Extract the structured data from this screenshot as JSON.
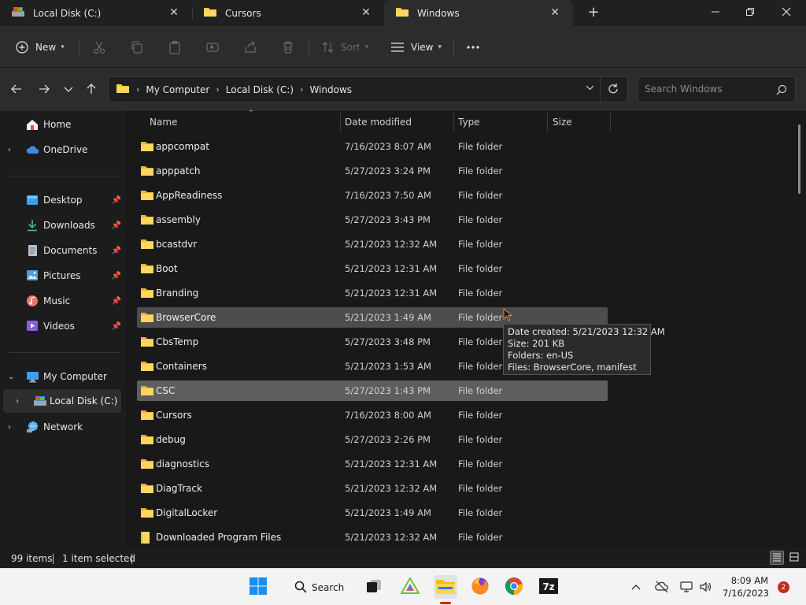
{
  "tabs": [
    {
      "label": "Local Disk (C:)",
      "icon": "drive-icon",
      "active": false
    },
    {
      "label": "Cursors",
      "icon": "folder-icon",
      "active": false
    },
    {
      "label": "Windows",
      "icon": "folder-icon",
      "active": true
    }
  ],
  "toolbar": {
    "new_label": "New",
    "sort_label": "Sort",
    "view_label": "View",
    "more_label": "···"
  },
  "address": {
    "crumbs": [
      "My Computer",
      "Local Disk (C:)",
      "Windows"
    ]
  },
  "search": {
    "placeholder": "Search Windows"
  },
  "nav": {
    "home": "Home",
    "onedrive": "OneDrive",
    "desktop": "Desktop",
    "downloads": "Downloads",
    "documents": "Documents",
    "pictures": "Pictures",
    "music": "Music",
    "videos": "Videos",
    "mycomputer": "My Computer",
    "localdisk": "Local Disk (C:)",
    "network": "Network"
  },
  "columns": {
    "name": "Name",
    "date": "Date modified",
    "type": "Type",
    "size": "Size"
  },
  "files": [
    {
      "name": "appcompat",
      "date": "7/16/2023 8:07 AM",
      "type": "File folder"
    },
    {
      "name": "apppatch",
      "date": "5/27/2023 3:24 PM",
      "type": "File folder"
    },
    {
      "name": "AppReadiness",
      "date": "7/16/2023 7:50 AM",
      "type": "File folder"
    },
    {
      "name": "assembly",
      "date": "5/27/2023 3:43 PM",
      "type": "File folder"
    },
    {
      "name": "bcastdvr",
      "date": "5/21/2023 12:32 AM",
      "type": "File folder"
    },
    {
      "name": "Boot",
      "date": "5/21/2023 12:31 AM",
      "type": "File folder"
    },
    {
      "name": "Branding",
      "date": "5/21/2023 12:31 AM",
      "type": "File folder"
    },
    {
      "name": "BrowserCore",
      "date": "5/21/2023 1:49 AM",
      "type": "File folder"
    },
    {
      "name": "CbsTemp",
      "date": "5/27/2023 3:48 PM",
      "type": "File folder"
    },
    {
      "name": "Containers",
      "date": "5/21/2023 1:53 AM",
      "type": "File folder"
    },
    {
      "name": "CSC",
      "date": "5/27/2023 1:43 PM",
      "type": "File folder"
    },
    {
      "name": "Cursors",
      "date": "7/16/2023 8:00 AM",
      "type": "File folder"
    },
    {
      "name": "debug",
      "date": "5/27/2023 2:26 PM",
      "type": "File folder"
    },
    {
      "name": "diagnostics",
      "date": "5/21/2023 12:31 AM",
      "type": "File folder"
    },
    {
      "name": "DiagTrack",
      "date": "5/21/2023 12:32 AM",
      "type": "File folder"
    },
    {
      "name": "DigitalLocker",
      "date": "5/21/2023 1:49 AM",
      "type": "File folder"
    },
    {
      "name": "Downloaded Program Files",
      "date": "5/21/2023 12:32 AM",
      "type": "File folder"
    }
  ],
  "tooltip": {
    "line1": "Date created: 5/21/2023 12:32 AM",
    "line2": "Size: 201 KB",
    "line3": "Folders: en-US",
    "line4": "Files: BrowserCore, manifest"
  },
  "status": {
    "items": "99 items",
    "selected": "1 item selected"
  },
  "taskbar": {
    "search_label": "Search",
    "time": "8:09 AM",
    "date": "7/16/2023",
    "notif_count": "2"
  },
  "colors": {
    "folder": "#f8c93a",
    "accent": "#c42b1c",
    "selection": "#5e5e5e",
    "hover": "#4d4d4d"
  }
}
